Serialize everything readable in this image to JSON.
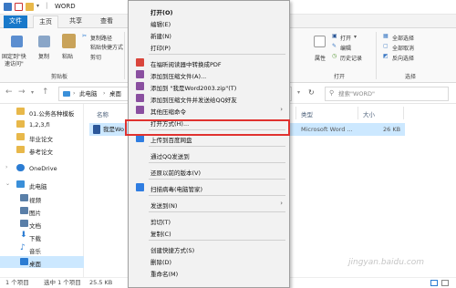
{
  "title": {
    "text": "WORD"
  },
  "ribbon_tabs": [
    "文件",
    "主页",
    "共享",
    "查看"
  ],
  "ribbon": {
    "pin_label_1": "固定到\"快",
    "pin_label_2": "速访问\"",
    "copy": "复制",
    "paste": "粘贴",
    "copy_path": "复制路径",
    "paste_shortcut": "粘贴快捷方式",
    "cut": "剪切",
    "clipboard_group": "剪贴板",
    "properties": "属性",
    "open": "打开",
    "edit": "编辑",
    "history": "历史记录",
    "open_group": "打开",
    "select_all": "全部选择",
    "select_none": "全部取消",
    "invert_select": "反向选择",
    "select_group": "选择"
  },
  "address": {
    "path1": "此电脑",
    "path2": "桌面",
    "search_placeholder": "搜索\"WORD\""
  },
  "nav": [
    {
      "label": "01.公务各种模板",
      "icon": "folder",
      "color": "#e8b84a"
    },
    {
      "label": "1,2,3,fi",
      "icon": "folder",
      "color": "#e8b84a"
    },
    {
      "label": "毕业论文",
      "icon": "folder",
      "color": "#e8b84a"
    },
    {
      "label": "参考论文",
      "icon": "folder",
      "color": "#e8b84a"
    },
    {
      "label": "OneDrive",
      "icon": "cloud",
      "color": "#2b7cd3"
    },
    {
      "label": "此电脑",
      "icon": "computer",
      "color": "#3a8fd9"
    },
    {
      "label": "视频",
      "icon": "video",
      "color": "#5a7fa8"
    },
    {
      "label": "图片",
      "icon": "picture",
      "color": "#5a7fa8"
    },
    {
      "label": "文档",
      "icon": "document",
      "color": "#5a7fa8"
    },
    {
      "label": "下载",
      "icon": "download",
      "color": "#2b7cd3"
    },
    {
      "label": "音乐",
      "icon": "music",
      "color": "#2b7cd3"
    },
    {
      "label": "桌面",
      "icon": "desktop",
      "color": "#2b7cd3"
    }
  ],
  "columns": {
    "name": "名称",
    "type": "类型",
    "size": "大小"
  },
  "file": {
    "name": "我是Wo",
    "type": "Microsoft Word ...",
    "size": "26 KB"
  },
  "status": {
    "count": "1 个项目",
    "selected": "选中 1 个项目",
    "size": "25.5 KB"
  },
  "menu": [
    {
      "label": "打开(O)",
      "bold": true
    },
    {
      "label": "编辑(E)"
    },
    {
      "label": "新建(N)"
    },
    {
      "label": "打印(P)"
    },
    {
      "sep": true
    },
    {
      "label": "在福昕阅读器中转换成PDF",
      "icon": "#d9453b"
    },
    {
      "label": "添加到压缩文件(A)...",
      "icon": "#8a4fa0"
    },
    {
      "label": "添加到 \"我是Word2003.zip\"(T)",
      "icon": "#8a4fa0"
    },
    {
      "label": "添加到压缩文件并发送给QQ好友",
      "icon": "#8a4fa0"
    },
    {
      "label": "其他压缩命令",
      "icon": "#8a4fa0",
      "submenu": true
    },
    {
      "label": "打开方式(H)...",
      "highlight": true
    },
    {
      "sep": true
    },
    {
      "label": "上传到百度网盘",
      "icon": "#2f7de1"
    },
    {
      "sep": true
    },
    {
      "label": "通过QQ发送到"
    },
    {
      "sep": true
    },
    {
      "label": "还原以前的版本(V)"
    },
    {
      "sep": true
    },
    {
      "label": "扫描病毒(电脑管家)",
      "icon": "#2f7de1"
    },
    {
      "sep": true
    },
    {
      "label": "发送到(N)",
      "submenu": true
    },
    {
      "sep": true
    },
    {
      "label": "剪切(T)"
    },
    {
      "label": "复制(C)"
    },
    {
      "sep": true
    },
    {
      "label": "创建快捷方式(S)"
    },
    {
      "label": "删除(D)"
    },
    {
      "label": "重命名(M)"
    }
  ],
  "watermark": {
    "text": "jingyan.baidu.com"
  },
  "colors": {
    "accent": "#1979ca",
    "highlight_box": "#e0322f",
    "selection": "#cce8ff"
  }
}
